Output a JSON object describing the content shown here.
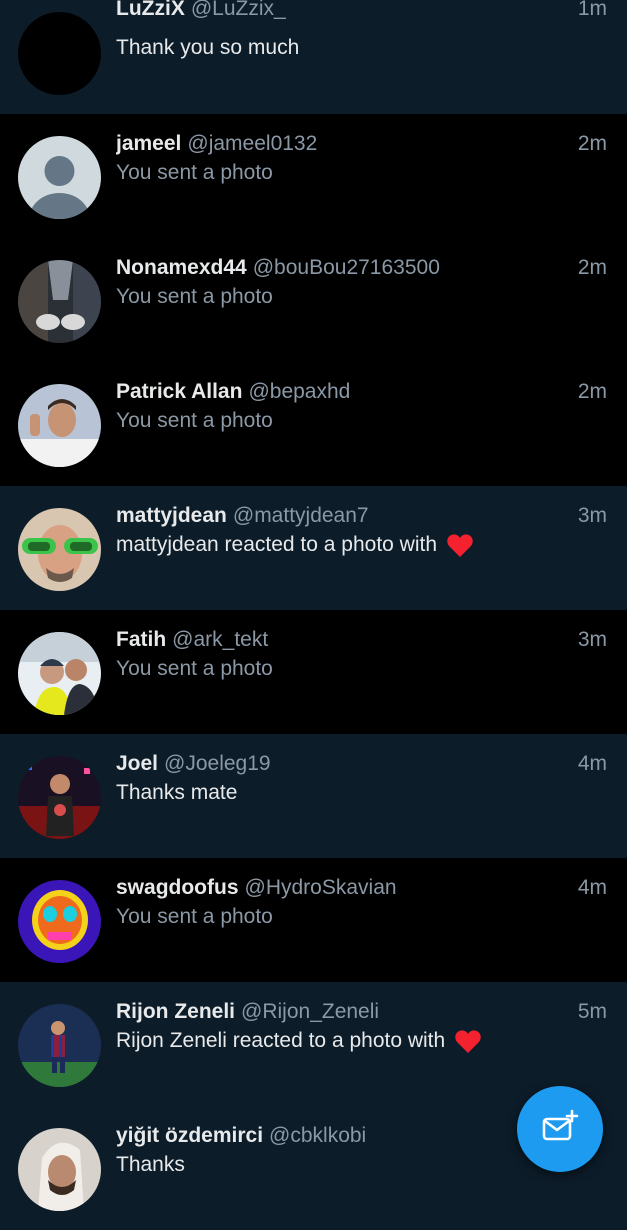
{
  "colors": {
    "unread_bg": "#0c1c29",
    "read_bg": "#000000",
    "primary_text": "#e7e9ea",
    "secondary_text": "#8b98a5",
    "accent": "#1d9bf0",
    "heart": "#f4212e"
  },
  "conversations": [
    {
      "name": "LuZziX",
      "handle": "@LuZzix_",
      "time": "1m",
      "message": "Thank you so much",
      "unread": true,
      "reaction_icon": ""
    },
    {
      "name": "jameel",
      "handle": "@jameel0132",
      "time": "2m",
      "message": "You sent a photo",
      "unread": false,
      "reaction_icon": ""
    },
    {
      "name": "Nonamexd44",
      "handle": "@bouBou27163500",
      "time": "2m",
      "message": "You sent a photo",
      "unread": false,
      "reaction_icon": ""
    },
    {
      "name": "Patrick Allan",
      "handle": "@bepaxhd",
      "time": "2m",
      "message": "You sent a photo",
      "unread": false,
      "reaction_icon": ""
    },
    {
      "name": "mattyjdean",
      "handle": "@mattyjdean7",
      "time": "3m",
      "message": "mattyjdean reacted to a photo with",
      "unread": true,
      "reaction_icon": "heart-icon"
    },
    {
      "name": "Fatih",
      "handle": "@ark_tekt",
      "time": "3m",
      "message": "You sent a photo",
      "unread": false,
      "reaction_icon": ""
    },
    {
      "name": "Joel",
      "handle": "@Joeleg19",
      "time": "4m",
      "message": "Thanks mate",
      "unread": true,
      "reaction_icon": ""
    },
    {
      "name": "swagdoofus",
      "handle": "@HydroSkavian",
      "time": "4m",
      "message": "You sent a photo",
      "unread": false,
      "reaction_icon": ""
    },
    {
      "name": "Rijon Zeneli",
      "handle": "@Rijon_Zeneli",
      "time": "5m",
      "message": "Rijon Zeneli reacted to a photo with",
      "unread": true,
      "reaction_icon": "heart-icon"
    },
    {
      "name": "yiğit özdemirci",
      "handle": "@cbklkobi",
      "time": "",
      "message": "Thanks",
      "unread": true,
      "reaction_icon": ""
    }
  ],
  "fab": {
    "icon": "new-message-icon"
  }
}
